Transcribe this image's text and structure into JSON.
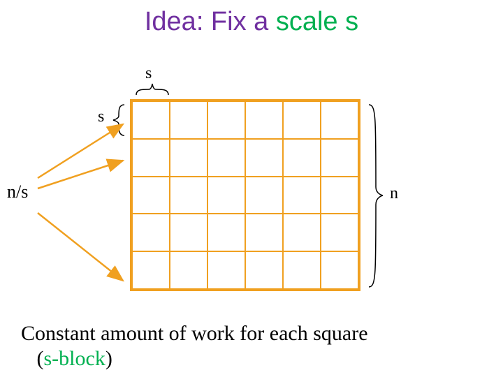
{
  "title": {
    "part1": "Idea: Fix a ",
    "part2": "scale s"
  },
  "labels": {
    "top_s": "s",
    "left_s": "s",
    "right_n": "n",
    "ns": "n/s"
  },
  "footer": {
    "line1a": "Constant amount of work for each square",
    "indent": "(",
    "green": "s-block",
    "close": ")"
  },
  "grid": {
    "cols": 6,
    "rows": 5
  },
  "colors": {
    "orange": "#f0a020",
    "purple": "#7030a0",
    "green": "#00b050"
  }
}
